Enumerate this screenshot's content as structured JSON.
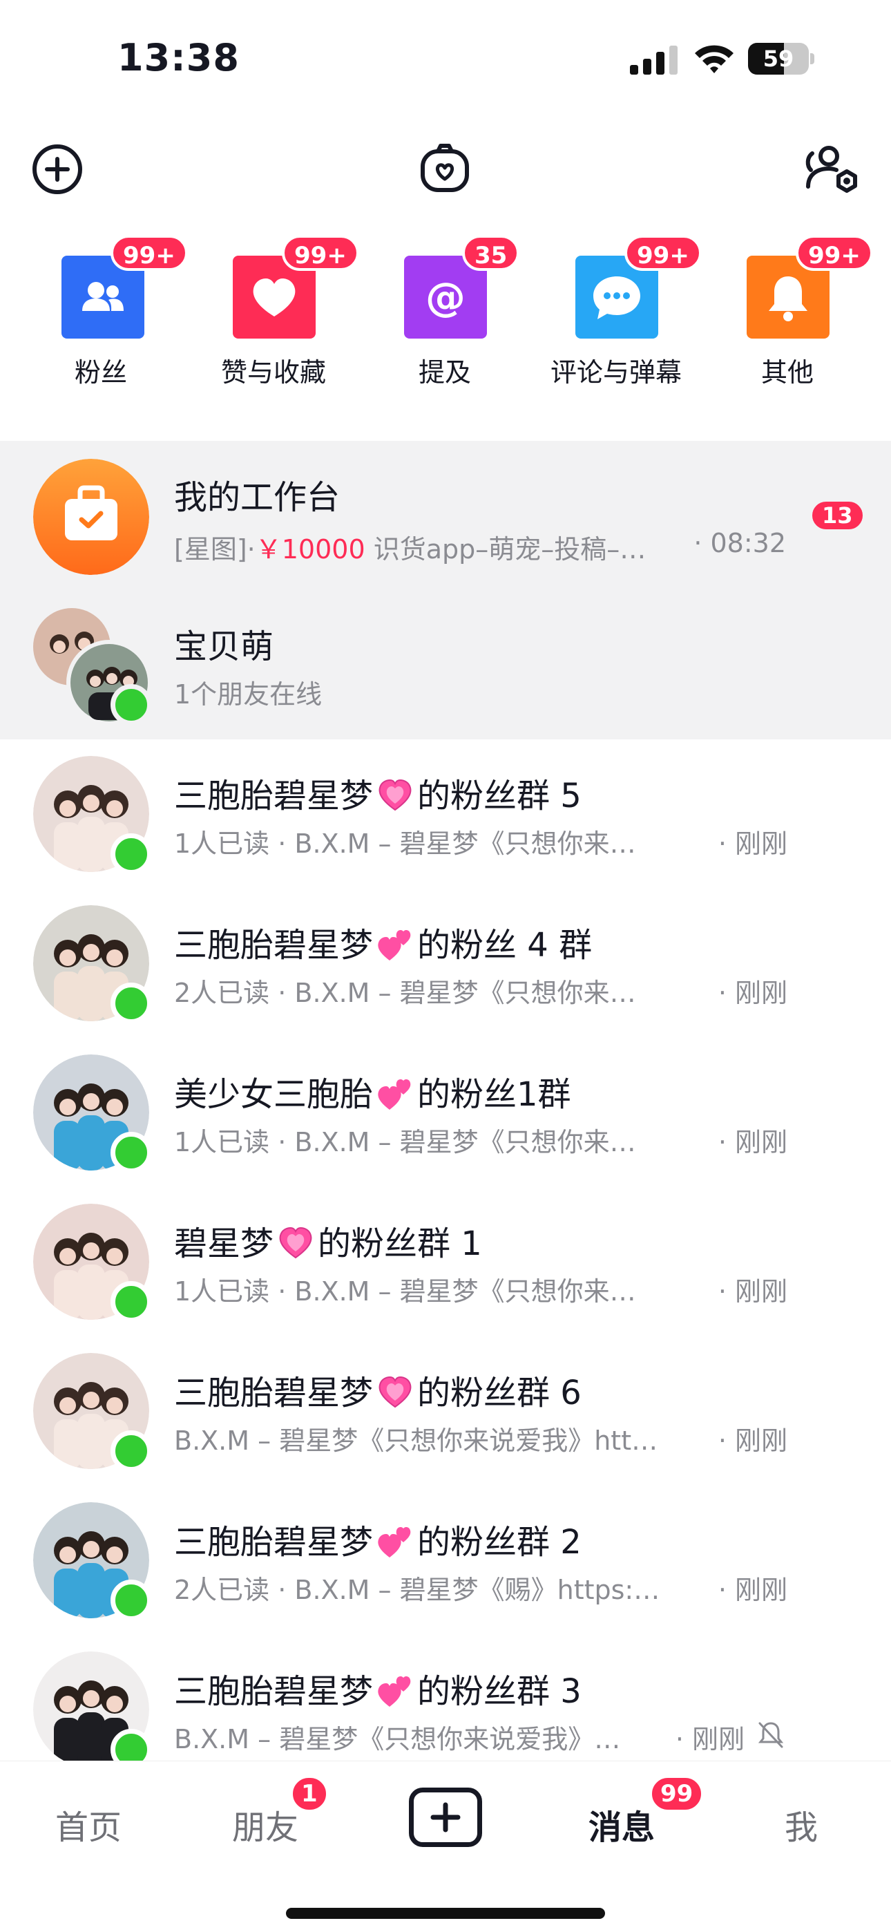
{
  "status_bar": {
    "time": "13:38",
    "battery": "59",
    "battery_level": 0.59
  },
  "categories": [
    {
      "label": "粉丝",
      "badge": "99+",
      "icon": "fans-icon",
      "color": "#2f6df6"
    },
    {
      "label": "赞与收藏",
      "badge": "99+",
      "icon": "heart-icon",
      "color": "#fe2c55"
    },
    {
      "label": "提及",
      "badge": "35",
      "icon": "at-icon",
      "color": "#a23df2"
    },
    {
      "label": "评论与弹幕",
      "badge": "99+",
      "icon": "comment-icon",
      "color": "#27a7f5"
    },
    {
      "label": "其他",
      "badge": "99+",
      "icon": "bell-icon",
      "color": "#ff7a1a"
    }
  ],
  "workbench": {
    "title": "我的工作台",
    "tag": "[星图]·",
    "price": "￥10000",
    "preview": " 识货app–萌宠–投稿–…",
    "time": "· 08:32",
    "badge": "13"
  },
  "baobeimeng": {
    "title": "宝贝萌",
    "subtitle": "1个朋友在线"
  },
  "chats": [
    {
      "title_pre": "三胞胎碧星梦",
      "heart": "💗",
      "title_post": "的粉丝群 5",
      "subtitle": "1人已读 · B.X.M – 碧星梦《只想你来…",
      "time": "· 刚刚"
    },
    {
      "title_pre": "三胞胎碧星梦",
      "heart": "💕",
      "title_post": "的粉丝 4 群",
      "subtitle": "2人已读 · B.X.M – 碧星梦《只想你来…",
      "time": "· 刚刚"
    },
    {
      "title_pre": "美少女三胞胎",
      "heart": "💕",
      "title_post": "的粉丝1群",
      "subtitle": "1人已读 · B.X.M – 碧星梦《只想你来…",
      "time": "· 刚刚"
    },
    {
      "title_pre": "碧星梦",
      "heart": "💗",
      "title_post": "的粉丝群 1",
      "subtitle": "1人已读 · B.X.M – 碧星梦《只想你来…",
      "time": "· 刚刚"
    },
    {
      "title_pre": "三胞胎碧星梦",
      "heart": "💗",
      "title_post": "的粉丝群 6",
      "subtitle": "B.X.M – 碧星梦《只想你来说爱我》htt…",
      "time": "· 刚刚"
    },
    {
      "title_pre": "三胞胎碧星梦",
      "heart": "💕",
      "title_post": "的粉丝群 2",
      "subtitle": "2人已读 · B.X.M – 碧星梦《赐》https:…",
      "time": "· 刚刚"
    },
    {
      "title_pre": "三胞胎碧星梦",
      "heart": "💕",
      "title_post": "的粉丝群 3",
      "subtitle": "B.X.M – 碧星梦《只想你来说爱我》…",
      "time": "· 刚刚"
    }
  ],
  "nav": {
    "home": "首页",
    "friends": "朋友",
    "friends_badge": "1",
    "messages": "消息",
    "messages_badge": "99",
    "me": "我"
  }
}
